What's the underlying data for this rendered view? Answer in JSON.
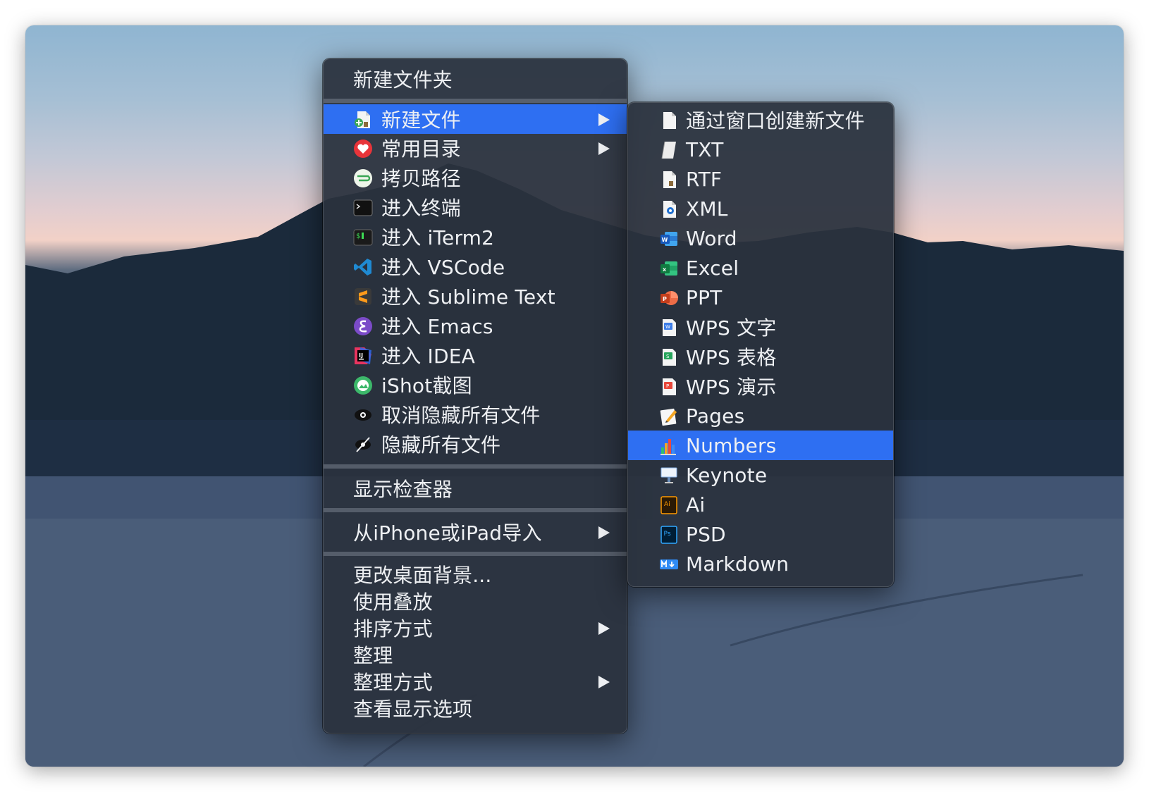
{
  "main_menu": {
    "new_folder": "新建文件夹",
    "items": [
      {
        "label": "新建文件",
        "icon": "new-file-icon",
        "submenu": true
      },
      {
        "label": "常用目录",
        "icon": "heart-icon",
        "submenu": true
      },
      {
        "label": "拷贝路径",
        "icon": "copy-path-icon",
        "submenu": false
      },
      {
        "label": "进入终端",
        "icon": "terminal-icon",
        "submenu": false
      },
      {
        "label": "进入 iTerm2",
        "icon": "iterm2-icon",
        "submenu": false
      },
      {
        "label": "进入 VSCode",
        "icon": "vscode-icon",
        "submenu": false
      },
      {
        "label": "进入 Sublime Text",
        "icon": "sublime-text-icon",
        "submenu": false
      },
      {
        "label": "进入 Emacs",
        "icon": "emacs-icon",
        "submenu": false
      },
      {
        "label": "进入 IDEA",
        "icon": "idea-icon",
        "submenu": false
      },
      {
        "label": "iShot截图",
        "icon": "ishot-icon",
        "submenu": false
      },
      {
        "label": "取消隐藏所有文件",
        "icon": "eye-icon",
        "submenu": false
      },
      {
        "label": "隐藏所有文件",
        "icon": "eye-slash-icon",
        "submenu": false
      }
    ],
    "show_inspector": "显示检查器",
    "import_from_iphone": "从iPhone或iPad导入",
    "change_background": "更改桌面背景...",
    "use_stacks": "使用叠放",
    "sort_by": "排序方式",
    "clean_up": "整理",
    "clean_up_by": "整理方式",
    "view_options": "查看显示选项"
  },
  "sub_menu": {
    "items": [
      {
        "label": "通过窗口创建新文件",
        "icon": "blank-document-icon"
      },
      {
        "label": "TXT",
        "icon": "txt-file-icon"
      },
      {
        "label": "RTF",
        "icon": "rtf-file-icon"
      },
      {
        "label": "XML",
        "icon": "xml-file-icon"
      },
      {
        "label": "Word",
        "icon": "word-icon"
      },
      {
        "label": "Excel",
        "icon": "excel-icon"
      },
      {
        "label": "PPT",
        "icon": "powerpoint-icon"
      },
      {
        "label": "WPS 文字",
        "icon": "wps-writer-icon"
      },
      {
        "label": "WPS 表格",
        "icon": "wps-spreadsheet-icon"
      },
      {
        "label": "WPS 演示",
        "icon": "wps-presentation-icon"
      },
      {
        "label": "Pages",
        "icon": "pages-icon"
      },
      {
        "label": "Numbers",
        "icon": "numbers-icon"
      },
      {
        "label": "Keynote",
        "icon": "keynote-icon"
      },
      {
        "label": "Ai",
        "icon": "illustrator-icon"
      },
      {
        "label": "PSD",
        "icon": "photoshop-icon"
      },
      {
        "label": "Markdown",
        "icon": "markdown-icon"
      }
    ]
  },
  "colors": {
    "selection": "#2e6ff2",
    "menu_background": "#2b323e",
    "menu_text": "#eef0f3"
  }
}
